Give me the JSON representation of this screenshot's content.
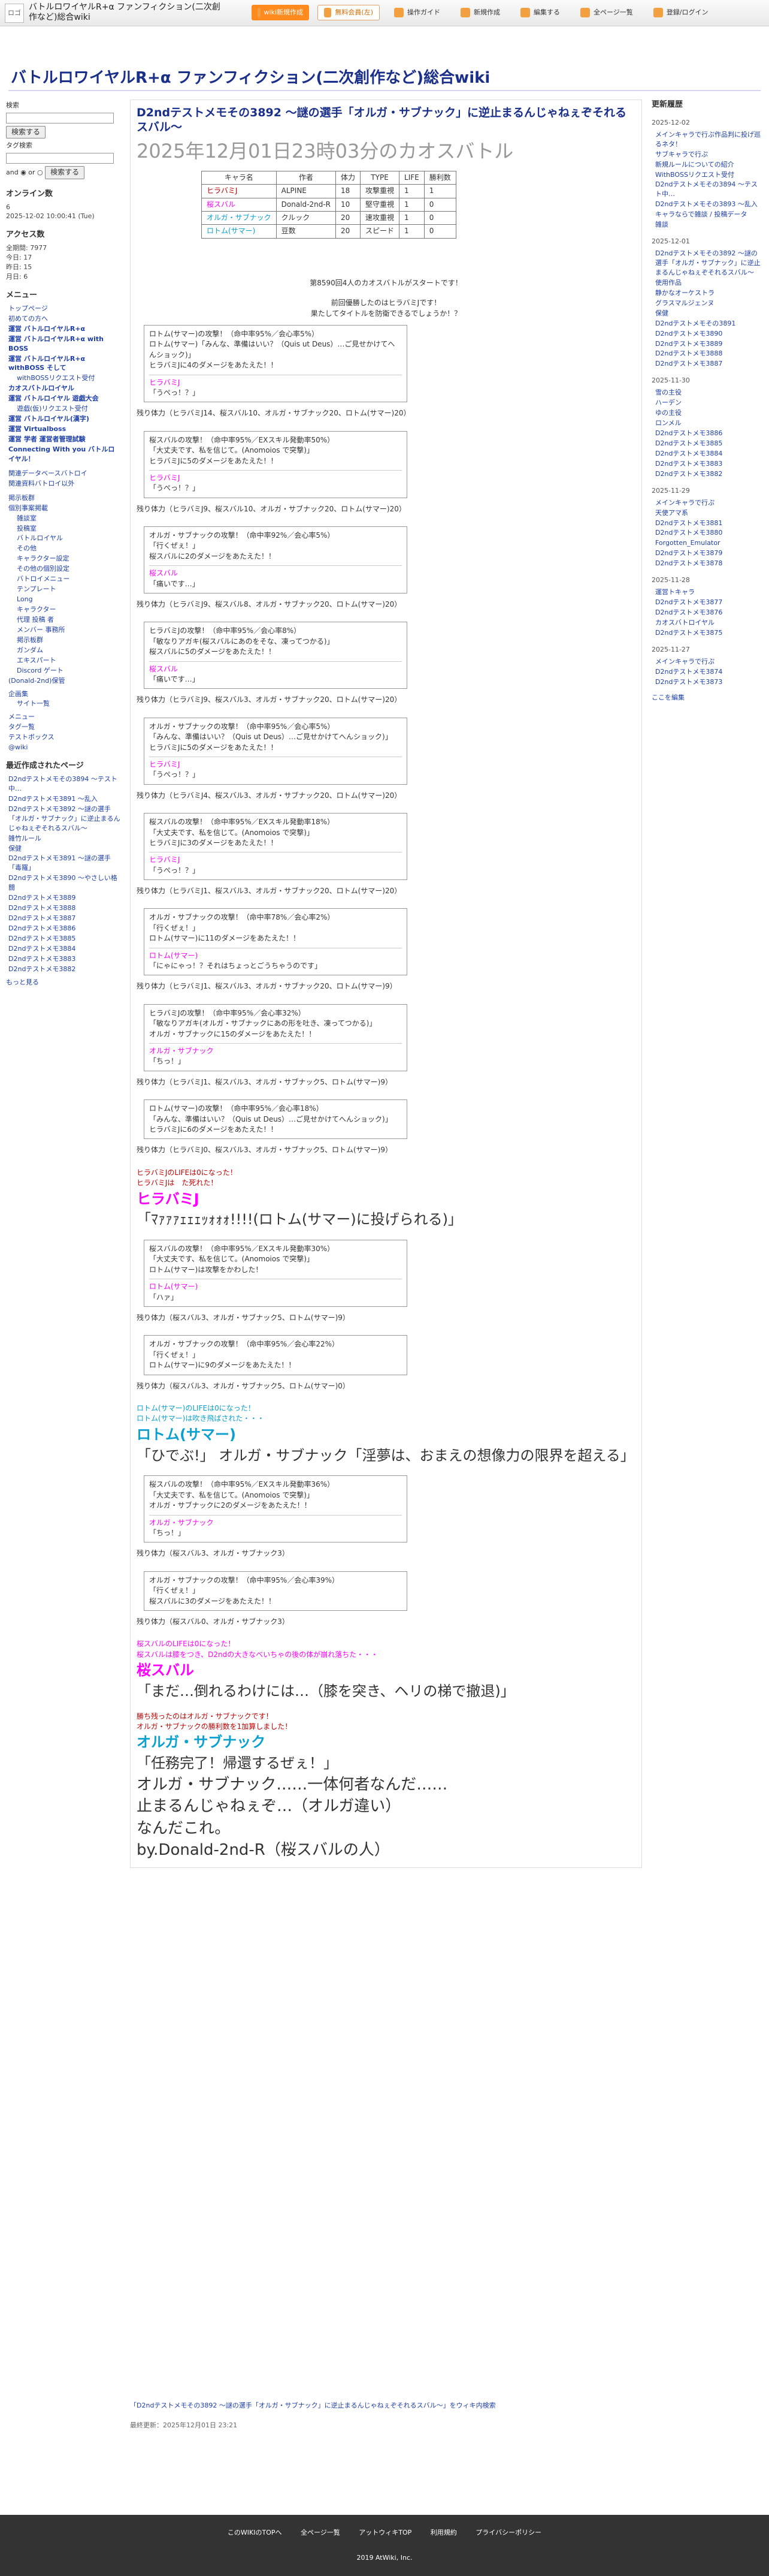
{
  "site": {
    "title": "バトルロワイヤルR+α ファンフィクション(二次創作など)総合wiki",
    "logo_alt": "ロゴ"
  },
  "topbar": {
    "buttons": [
      "wiki新規作成",
      "無料会員(左)",
      "操作ガイド",
      "新規作成",
      "編集する",
      "全ページ一覧",
      "登録/ログイン"
    ]
  },
  "leftcol": {
    "search_label": "検索",
    "search_btn": "検索する",
    "tag_label": "タグ検索",
    "tag_btn": "検索する",
    "and_or": "and ◉ or ○",
    "online_title": "オンライン数",
    "online_value": "6",
    "date": "2025-12-02 10:00:41 (Tue)",
    "access_title": "アクセス数",
    "access": [
      "全期間: 7977",
      "今日: 17",
      "昨日: 15",
      "月日: 6"
    ],
    "menu_title": "メニュー",
    "menu": [
      {
        "t": "トップページ",
        "c": ""
      },
      {
        "t": "初めての方へ",
        "c": ""
      },
      {
        "t": "運営 バトルロイヤルR+α",
        "c": "b"
      },
      {
        "t": "運営 バトルロイヤルR+α with BOSS",
        "c": "b"
      },
      {
        "t": "運営 バトルロイヤルR+α withBOSS そして",
        "c": "b"
      },
      {
        "t": "withBOSSリクエスト受付",
        "c": "sub"
      },
      {
        "t": "カオスバトルロイヤル",
        "c": "b"
      },
      {
        "t": "運営 バトルロイヤル 遊戯大会",
        "c": "b"
      },
      {
        "t": "遊戯(仮)リクエスト受付",
        "c": "sub"
      },
      {
        "t": "運営 バトルロイヤル(漢字)",
        "c": "b"
      },
      {
        "t": "運営 Virtualboss",
        "c": "b"
      },
      {
        "t": "運営 学者 運営者管理試験",
        "c": "b"
      },
      {
        "t": "Connecting With you バトルロイヤル！",
        "c": "b"
      }
    ],
    "archive": [
      "関連データベースバトロイ",
      "関連資料バトロイ以外"
    ],
    "sub_menu": [
      "掲示板群",
      "個別事案掲載",
      "雑談室",
      "投稿室",
      "バトルロイヤル",
      "その他",
      "キャラクター設定",
      "その他の個別設定",
      "バトロイメニュー",
      "テンプレート",
      "Long",
      "キャラクター",
      "代理 投稿 者",
      "メンバー 事務所",
      "掲示板群",
      "ガンダム",
      "エキスパート",
      "Discord ゲート",
      "(Donald-2nd)保管"
    ],
    "sub2": [
      "企画集",
      "サイト一覧"
    ],
    "others": [
      "メニュー",
      "タグ一覧",
      "テストボックス",
      "@wiki"
    ],
    "recent_title": "最近作成されたページ",
    "recent": [
      "D2ndテストメモその3894 ～テスト中…",
      "D2ndテストメモ3891 ～乱入",
      "D2ndテストメモ3892 ～謎の選手「オルガ・サブナック」に逆止まるんじゃねぇぞそれるスバル～",
      "雑竹ルール",
      "保健",
      "D2ndテストメモ3891 ～謎の選手「毒羅」",
      "D2ndテストメモ3890 ～やさしい格闘",
      "D2ndテストメモ3889",
      "D2ndテストメモ3888",
      "D2ndテストメモ3887",
      "D2ndテストメモ3886",
      "D2ndテストメモ3885",
      "D2ndテストメモ3884",
      "D2ndテストメモ3883",
      "D2ndテストメモ3882"
    ],
    "more": "もっと見る"
  },
  "article": {
    "title": "D2ndテストメモその3892 ～謎の選手「オルガ・サブナック」に逆止まるんじゃねぇぞそれるスバル～",
    "subtitle": "2025年12月01日23時03分のカオスバトル",
    "table_head": [
      "キャラ名",
      "作者",
      "体力",
      "TYPE",
      "LIFE",
      "勝利数"
    ],
    "table_rows": [
      [
        "ヒラバミJ",
        "ALPINE",
        "18",
        "攻撃重視",
        "1",
        "1"
      ],
      [
        "桜スバル",
        "Donald-2nd-R",
        "10",
        "堅守重視",
        "1",
        "0"
      ],
      [
        "オルガ・サブナック",
        "クルック",
        "20",
        "速攻重視",
        "1",
        "0"
      ],
      [
        "ロトム(サマー)",
        "豆数",
        "20",
        "スピード",
        "1",
        "0"
      ]
    ],
    "start": "第8590回4人のカオスバトルがスタートです！",
    "rule1": "前回優勝したのはヒラバミJです！",
    "rule2": "果たしてタイトルを防衛できるでしょうか！？",
    "logs": [
      {
        "a": "ロトム(サマー)の攻撃！（命中率95%／会心率5%）",
        "b": "ロトム(サマー)「みんな、準備はいい？（Quis ut Deus）…ご見せかけてへんショック)」",
        "c": "ヒラバミJに4のダメージをあたえた！！",
        "d": "ヒラバミJ",
        "e": "「うぺっ！？」",
        "rem": "残り体力（ヒラバミJ14、桜スバル10、オルガ・サブナック20、ロトム(サマー)20）"
      },
      {
        "a": "桜スバルの攻撃！（命中率95%／EXスキル発動率50%）",
        "b": "「大丈夫です、私を信じて。(Anomoios で突撃)」",
        "c": "ヒラバミJに5のダメージをあたえた！！",
        "d": "ヒラバミJ",
        "e": "「うぺっ！？」",
        "rem": "残り体力（ヒラバミJ9、桜スバル10、オルガ・サブナック20、ロトム(サマー)20）"
      },
      {
        "a": "オルガ・サブナックの攻撃！（命中率92%／会心率5%）",
        "b": "「行くぜぇ！」",
        "c": "桜スバルに2のダメージをあたえた！！",
        "d": "桜スバル",
        "e": "「痛いです…」",
        "rem": "残り体力（ヒラバミJ9、桜スバル8、オルガ・サブナック20、ロトム(サマー)20）"
      },
      {
        "a": "ヒラバミJの攻撃！（命中率95%／会心率8%）",
        "b": "「敏なりアガキ(桜スバルにあのをそな、凍ってつかる)」",
        "c": "桜スバルに5のダメージをあたえた！！",
        "d": "桜スバル",
        "e": "「痛いです…」",
        "rem": "残り体力（ヒラバミJ9、桜スバル3、オルガ・サブナック20、ロトム(サマー)20）"
      },
      {
        "a": "オルガ・サブナックの攻撃！（命中率95%／会心率5%）",
        "b": "「みんな、準備はいい？（Quis ut Deus）…ご見せかけてへんショック)」",
        "c": "ヒラバミJに5のダメージをあたえた！！",
        "d": "ヒラバミJ",
        "e": "「うぺっ！？」",
        "rem": "残り体力（ヒラバミJ4、桜スバル3、オルガ・サブナック20、ロトム(サマー)20）"
      },
      {
        "a": "桜スバルの攻撃！（命中率95%／EXスキル発動率18%）",
        "b": "「大丈夫です、私を信じて。(Anomoios で突撃)」",
        "c": "ヒラバミJに3のダメージをあたえた！！",
        "d": "ヒラバミJ",
        "e": "「うぺっ！？」",
        "rem": "残り体力（ヒラバミJ1、桜スバル3、オルガ・サブナック20、ロトム(サマー)20）"
      },
      {
        "a": "オルガ・サブナックの攻撃！（命中率78%／会心率2%）",
        "b": "「行くぜぇ！」",
        "c": "ロトム(サマー)に11のダメージをあたえた！！",
        "d": "ロトム(サマー)",
        "e": "「にゃにゃっ！？それはちょっとごうちゃうのです」",
        "rem": "残り体力（ヒラバミJ1、桜スバル3、オルガ・サブナック20、ロトム(サマー)9）"
      },
      {
        "a": "ヒラバミJの攻撃！（命中率95%／会心率32%）",
        "b": "「敏なりアガキ(オルガ・サブナックにあの形を吐き、凍ってつかる)」",
        "c": "オルガ・サブナックに15のダメージをあたえた！！",
        "d": "オルガ・サブナック",
        "e": "「ちっ！」",
        "rem": "残り体力（ヒラバミJ1、桜スバル3、オルガ・サブナック5、ロトム(サマー)9）"
      },
      {
        "a": "ロトム(サマー)の攻撃！（命中率95%／会心率18%）",
        "b": "「みんな、準備はいい？（Quis ut Deus）…ご見せかけてへんショック)」",
        "c": "ヒラバミJに6のダメージをあたえた！！",
        "d": "",
        "e": "",
        "rem": "残り体力（ヒラバミJ0、桜スバル3、オルガ・サブナック5、ロトム(サマー)9）"
      }
    ],
    "ko1": "ヒラバミJのLIFEは0になった！",
    "ko1b": "ヒラバミJは　た死れた！",
    "ko1name": "ヒラバミJ",
    "ko1quote": "「ﾏｧｧｧｪｪｪｯｫｫｫ!!!!(ロトム(サマー)に投げられる)」",
    "logs2": [
      {
        "a": "桜スバルの攻撃！（命中率95%／EXスキル発動率30%）",
        "b": "「大丈夫です、私を信じて。(Anomoios で突撃)」",
        "c": "ロトム(サマー)は攻撃をかわした！",
        "d": "ロトム(サマー)",
        "e": "「ハァ」",
        "rem": "残り体力（桜スバル3、オルガ・サブナック5、ロトム(サマー)9）"
      },
      {
        "a": "オルガ・サブナックの攻撃！（命中率95%／会心率22%）",
        "b": "「行くぜぇ！」",
        "c": "ロトム(サマー)に9のダメージをあたえた！！",
        "d": "",
        "e": "",
        "rem": "残り体力（桜スバル3、オルガ・サブナック5、ロトム(サマー)0）"
      }
    ],
    "ko2": "ロトム(サマー)のLIFEは0になった！",
    "ko2b": "ロトム(サマー)は吹き飛ばされた・・・",
    "ko2name": "ロトム(サマー)",
    "ko2quote": "「ひでぶ!」 オルガ・サブナック「淫夢は、おまえの想像力の限界を超える」",
    "logs3": [
      {
        "a": "桜スバルの攻撃！（命中率95%／EXスキル発動率36%）",
        "b": "「大丈夫です、私を信じて。(Anomoios で突撃)」",
        "c": "オルガ・サブナックに2のダメージをあたえた！！",
        "d": "オルガ・サブナック",
        "e": "「ちっ！」",
        "rem": "残り体力（桜スバル3、オルガ・サブナック3）"
      },
      {
        "a": "オルガ・サブナックの攻撃！（命中率95%／会心率39%）",
        "b": "「行くぜぇ！」",
        "c": "桜スバルに3のダメージをあたえた！！",
        "d": "",
        "e": "",
        "rem": "残り体力（桜スバル0、オルガ・サブナック3）"
      }
    ],
    "ko3": "桜スバルのLIFEは0になった！",
    "ko3b": "桜スバルは膝をつき、D2ndの大きなべいちゃの後の体が崩れ落ちた・・・",
    "ko3name": "桜スバル",
    "ko3quote": "「まだ…倒れるわけには…（膝を突き、ヘリの梯で撤退)」",
    "win1": "勝ち残ったのはオルガ・サブナックです！",
    "win2": "オルガ・サブナックの勝利数を1加算しました！",
    "win_name": "オルガ・サブナック",
    "win_quote": "「任務完了！帰還するぜぇ！」",
    "final1": "オルガ・サブナック……一体何者なんだ……",
    "final2": "止まるんじゃねぇぞ…（オルガ違い）",
    "final3": "なんだこれ。",
    "final4": "by.Donald-2nd-R（桜スバルの人）"
  },
  "right": {
    "title": "更新履歴",
    "groups": [
      {
        "date": "2025-12-02",
        "items": [
          "メインキャラで行ぷ作品判に投げ巡るネタ！",
          "サブキャラで行ぷ",
          "新規ルールについての紹介",
          "WithBOSSリクエスト受付",
          "D2ndテストメモその3894 ～テスト中…",
          "D2ndテストメモその3893 ～乱入",
          "キャラならで雑談 / 投稿データ",
          "雑談"
        ]
      },
      {
        "date": "2025-12-01",
        "items": [
          "D2ndテストメモその3892 ～謎の選手「オルガ・サブナック」に逆止まるんじゃねぇぞそれるスバル～",
          "使用作品",
          "静かなオーケストラ",
          "グラスマルジェンヌ",
          "保健",
          "D2ndテストメモその3891",
          "D2ndテストメモ3890",
          "D2ndテストメモ3889",
          "D2ndテストメモ3888",
          "D2ndテストメモ3887"
        ]
      },
      {
        "date": "2025-11-30",
        "items": [
          "雪の主役",
          "ハーデン",
          "ゆの主役",
          "ロンメル",
          "D2ndテストメモ3886",
          "D2ndテストメモ3885",
          "D2ndテストメモ3884",
          "D2ndテストメモ3883",
          "D2ndテストメモ3882"
        ]
      },
      {
        "date": "2025-11-29",
        "items": [
          "メインキャラで行ぷ",
          "天使アマ系",
          "D2ndテストメモ3881",
          "D2ndテストメモ3880",
          "Forgotten_Emulator",
          "D2ndテストメモ3879",
          "D2ndテストメモ3878"
        ]
      },
      {
        "date": "2025-11-28",
        "items": [
          "運営トキャラ",
          "D2ndテストメモ3877",
          "D2ndテストメモ3876",
          "カオスバトロイヤル",
          "D2ndテストメモ3875"
        ]
      },
      {
        "date": "2025-11-27",
        "items": [
          "メインキャラで行ぷ",
          "D2ndテストメモ3874",
          "D2ndテストメモ3873"
        ]
      }
    ],
    "more": "ここを編集"
  },
  "breadcrumb": "「D2ndテストメモその3892 ～謎の選手「オルガ・サブナック」に逆止まるんじゃねぇぞそれるスバル～」をウィキ内検索",
  "update": "最終更新：2025年12月01日 23:21",
  "footer": {
    "links": [
      "このWIKIのTOPへ",
      "全ページ一覧",
      "アットウィキTOP",
      "利用規約",
      "プライバシーポリシー"
    ],
    "copy": "2019 AtWiki, Inc."
  }
}
